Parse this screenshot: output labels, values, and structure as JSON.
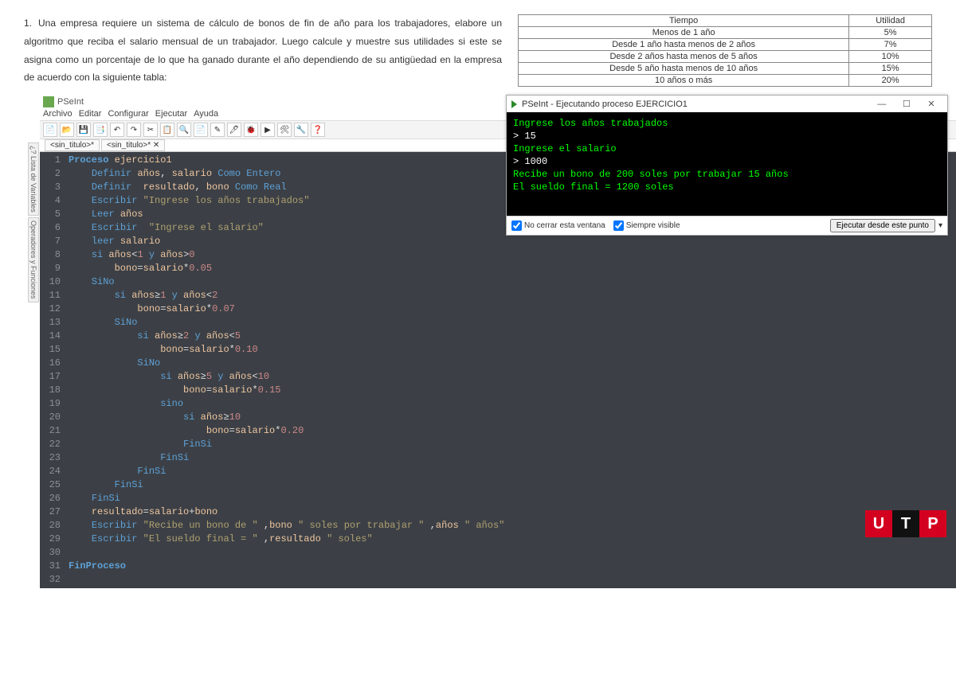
{
  "problem": {
    "number": "1.",
    "text": "Una empresa requiere un sistema de cálculo de bonos de fin de año para los trabajadores, elabore un algoritmo que reciba el salario mensual de un trabajador. Luego calcule y muestre sus utilidades si este se asigna como un porcentaje de lo que ha ganado durante el año dependiendo de su antigüedad en la empresa de acuerdo con la siguiente tabla:"
  },
  "utility_table": {
    "headers": [
      "Tiempo",
      "Utilidad"
    ],
    "rows": [
      [
        "Menos de 1 año",
        "5%"
      ],
      [
        "Desde 1 año hasta menos de 2 años",
        "7%"
      ],
      [
        "Desde 2 años hasta menos de 5 años",
        "10%"
      ],
      [
        "Desde 5 año hasta menos de 10 años",
        "15%"
      ],
      [
        "10 años o más",
        "20%"
      ]
    ]
  },
  "ide": {
    "title": "PSeInt",
    "menu": [
      "Archivo",
      "Editar",
      "Configurar",
      "Ejecutar",
      "Ayuda"
    ],
    "tabs": [
      "<sin_titulo>*",
      "<sin_titulo>*"
    ],
    "side_tabs": [
      "¿? Lista de Variables",
      "Operadores y Funciones"
    ]
  },
  "code": {
    "lines": [
      {
        "n": 1,
        "html": "<span class='kw'>Proceso</span> <span class='var'>ejercicio1</span>"
      },
      {
        "n": 2,
        "html": "    <span class='kw2'>Definir</span> <span class='var'>años</span>, <span class='var'>salario</span> <span class='kw2'>Como Entero</span>"
      },
      {
        "n": 3,
        "html": "    <span class='kw2'>Definir</span>  <span class='var'>resultado</span>, <span class='var'>bono</span> <span class='kw2'>Como Real</span>"
      },
      {
        "n": 4,
        "html": "    <span class='kw2'>Escribir</span> <span class='lit'>\"Ingrese los años trabajados\"</span>"
      },
      {
        "n": 5,
        "html": "    <span class='kw2'>Leer</span> <span class='var'>años</span>"
      },
      {
        "n": 6,
        "html": "    <span class='kw2'>Escribir</span>  <span class='lit'>\"Ingrese el salario\"</span>"
      },
      {
        "n": 7,
        "html": "    <span class='kw2'>leer</span> <span class='var'>salario</span>"
      },
      {
        "n": 8,
        "html": "    <span class='kw2'>si</span> <span class='var'>años</span>&lt;<span class='num2'>1</span> <span class='kw2'>y</span> <span class='var'>años</span>&gt;<span class='num2'>0</span>"
      },
      {
        "n": 9,
        "html": "        <span class='var'>bono</span>=<span class='var'>salario</span>*<span class='num2'>0.05</span>"
      },
      {
        "n": 10,
        "html": "    <span class='kw2'>SiNo</span>"
      },
      {
        "n": 11,
        "html": "        <span class='kw2'>si</span> <span class='var'>años</span>≥<span class='num2'>1</span> <span class='kw2'>y</span> <span class='var'>años</span>&lt;<span class='num2'>2</span>"
      },
      {
        "n": 12,
        "html": "            <span class='var'>bono</span>=<span class='var'>salario</span>*<span class='num2'>0.07</span>"
      },
      {
        "n": 13,
        "html": "        <span class='kw2'>SiNo</span>"
      },
      {
        "n": 14,
        "html": "            <span class='kw2'>si</span> <span class='var'>años</span>≥<span class='num2'>2</span> <span class='kw2'>y</span> <span class='var'>años</span>&lt;<span class='num2'>5</span>"
      },
      {
        "n": 15,
        "html": "                <span class='var'>bono</span>=<span class='var'>salario</span>*<span class='num2'>0.10</span>"
      },
      {
        "n": 16,
        "html": "            <span class='kw2'>SiNo</span>"
      },
      {
        "n": 17,
        "html": "                <span class='kw2'>si</span> <span class='var'>años</span>≥<span class='num2'>5</span> <span class='kw2'>y</span> <span class='var'>años</span>&lt;<span class='num2'>10</span>"
      },
      {
        "n": 18,
        "html": "                    <span class='var'>bono</span>=<span class='var'>salario</span>*<span class='num2'>0.15</span>"
      },
      {
        "n": 19,
        "html": "                <span class='kw2'>sino</span>"
      },
      {
        "n": 20,
        "html": "                    <span class='kw2'>si</span> <span class='var'>años</span>≥<span class='num2'>10</span>"
      },
      {
        "n": 21,
        "html": "                        <span class='var'>bono</span>=<span class='var'>salario</span>*<span class='num2'>0.20</span>"
      },
      {
        "n": 22,
        "html": "                    <span class='kw2'>FinSi</span>"
      },
      {
        "n": 23,
        "html": "                <span class='kw2'>FinSi</span>"
      },
      {
        "n": 24,
        "html": "            <span class='kw2'>FinSi</span>"
      },
      {
        "n": 25,
        "html": "        <span class='kw2'>FinSi</span>"
      },
      {
        "n": 26,
        "html": "    <span class='kw2'>FinSi</span>"
      },
      {
        "n": 27,
        "html": "    <span class='var'>resultado</span>=<span class='var'>salario</span>+<span class='var'>bono</span>"
      },
      {
        "n": 28,
        "html": "    <span class='kw2'>Escribir</span> <span class='lit'>\"Recibe un bono de \"</span> ,<span class='var'>bono</span> <span class='lit'>\" soles por trabajar \"</span> ,<span class='var'>años</span> <span class='lit'>\" años\"</span>"
      },
      {
        "n": 29,
        "html": "    <span class='kw2'>Escribir</span> <span class='lit'>\"El sueldo final = \"</span> ,<span class='var'>resultado</span> <span class='lit'>\" soles\"</span>"
      },
      {
        "n": 30,
        "html": ""
      },
      {
        "n": 31,
        "html": "<span class='kw'>FinProceso</span>"
      },
      {
        "n": 32,
        "html": ""
      }
    ]
  },
  "console": {
    "title": "PSeInt - Ejecutando proceso EJERCICIO1",
    "lines": [
      {
        "cls": "out",
        "text": "Ingrese los años trabajados"
      },
      {
        "cls": "in",
        "text": "> 15"
      },
      {
        "cls": "out",
        "text": "Ingrese el salario"
      },
      {
        "cls": "in",
        "text": "> 1000"
      },
      {
        "cls": "out",
        "text": "Recibe un bono de 200 soles por trabajar 15 años"
      },
      {
        "cls": "out",
        "text": "El sueldo final = 1200 soles"
      }
    ],
    "footer": {
      "no_cerrar": "No cerrar esta ventana",
      "siempre": "Siempre visible",
      "ejecutar": "Ejecutar desde este punto"
    }
  },
  "toolbar_icons": [
    "📄",
    "📂",
    "💾",
    "📑",
    "↶",
    "↷",
    "✂",
    "📋",
    "🔍",
    "📄",
    "✎",
    "🖊",
    "🐞",
    "▶",
    "🛠",
    "🔧",
    "❓"
  ],
  "logo": {
    "u": "U",
    "t": "T",
    "p": "P"
  }
}
